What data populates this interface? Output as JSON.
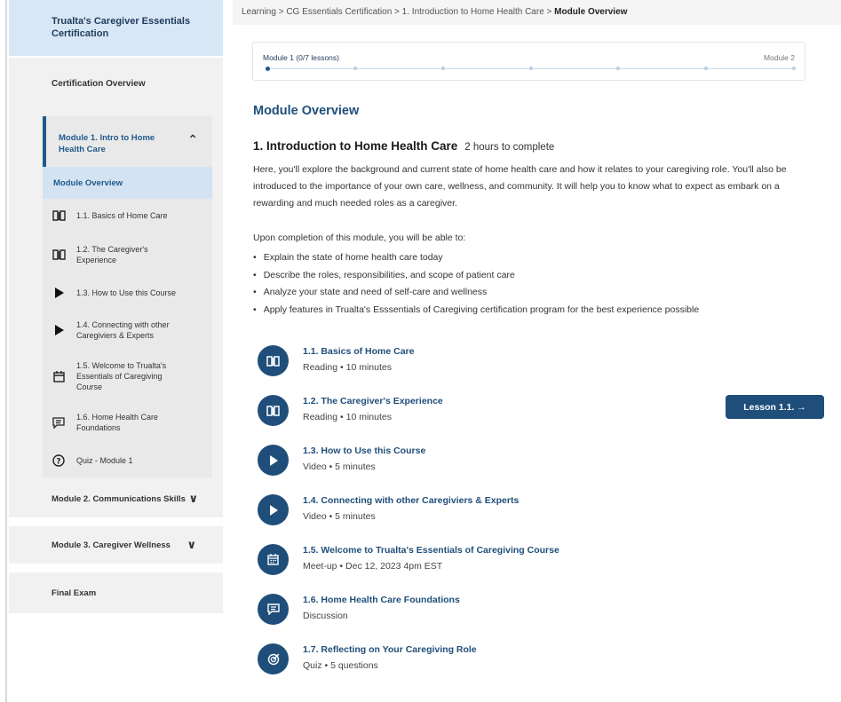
{
  "sidebar": {
    "title": "Trualta's Caregiver Essentials Certification",
    "overview": "Certification Overview",
    "module1": {
      "label": "Module 1. Intro to Home Health Care",
      "active_item": "Module Overview",
      "items": [
        {
          "label": "1.1. Basics of Home Care",
          "icon": "book-icon"
        },
        {
          "label": "1.2. The Caregiver's Experience",
          "icon": "book-icon"
        },
        {
          "label": "1.3. How to Use this Course",
          "icon": "play-icon"
        },
        {
          "label": "1.4. Connecting with other Caregiviers & Experts",
          "icon": "play-icon"
        },
        {
          "label": "1.5. Welcome to Trualta's Essentials of Caregiving Course",
          "icon": "calendar-icon"
        },
        {
          "label": "1.6. Home Health Care Foundations",
          "icon": "chat-icon"
        },
        {
          "label": "Quiz - Module 1",
          "icon": "question-icon"
        }
      ]
    },
    "module2": "Module 2. Communications Skills",
    "module3": "Module 3. Caregiver Wellness",
    "final": "Final Exam"
  },
  "breadcrumb": {
    "items": [
      "Learning",
      "CG Essentials Certification",
      "1. Introduction to Home Health Care"
    ],
    "current": "Module Overview",
    "separator": ">"
  },
  "progress": {
    "label": "Module 1 (0/7 lessons)",
    "next": "Module 2",
    "completed": 0,
    "total": 7
  },
  "main": {
    "heading": "Module Overview",
    "module_title": "1. Introduction to Home Health Care",
    "duration": "2 hours to complete",
    "description": "Here, you'll explore the background and current state of home health care and how it relates to your caregiving role. You'll also be introduced to the importance of your own care, wellness, and community. It will help you to know what to expect as embark on a rewarding and much needed roles as a caregiver.",
    "objectives_intro": "Upon completion of this module, you will be able to:",
    "objectives": [
      "Explain the state of home health care today",
      "Describe the roles, responsibilities, and scope of patient care",
      "Analyze your state and need of self-care and wellness",
      "Apply features in Trualta's Esssentials of Caregiving certification program for the best experience possible"
    ],
    "lessons": [
      {
        "title": "1.1. Basics of Home Care",
        "meta": "Reading • 10 minutes",
        "icon": "book-icon"
      },
      {
        "title": "1.2. The Caregiver's Experience",
        "meta": "Reading • 10 minutes",
        "icon": "book-icon"
      },
      {
        "title": "1.3. How to Use this Course",
        "meta": "Video • 5 minutes",
        "icon": "play-icon"
      },
      {
        "title": "1.4. Connecting with other Caregiviers & Experts",
        "meta": "Video • 5 minutes",
        "icon": "play-icon"
      },
      {
        "title": "1.5. Welcome to Trualta's Essentials of Caregiving Course",
        "meta": "Meet-up • Dec 12, 2023 4pm EST",
        "icon": "calendar-icon"
      },
      {
        "title": "1.6. Home Health Care Foundations",
        "meta": "Discussion",
        "icon": "chat-icon"
      },
      {
        "title": "1.7. Reflecting on Your Caregiving Role",
        "meta": "Quiz • 5 questions",
        "icon": "target-icon"
      }
    ],
    "cta": "Lesson 1.1. →"
  },
  "colors": {
    "primary": "#1f4e7a",
    "sidebar_title_bg": "#d8e7f5",
    "active_item_bg": "#d4e3f2"
  }
}
